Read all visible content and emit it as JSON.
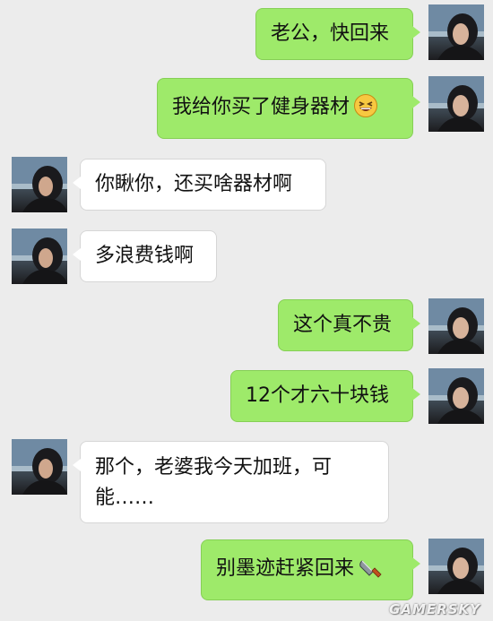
{
  "app": {
    "type": "chat-conversation",
    "colors": {
      "background": "#ececec",
      "sent_bubble": "#9eea6a",
      "received_bubble": "#ffffff"
    }
  },
  "messages": [
    {
      "side": "sent",
      "text": "老公，快回来"
    },
    {
      "side": "sent",
      "text": "我给你买了健身器材",
      "emoji": "grinning-squint-face-icon"
    },
    {
      "side": "received",
      "text": "你瞅你，还买啥器材啊"
    },
    {
      "side": "received",
      "text": "多浪费钱啊"
    },
    {
      "side": "sent",
      "text": "这个真不贵"
    },
    {
      "side": "sent",
      "text": "12个才六十块钱"
    },
    {
      "side": "received",
      "text": "那个，老婆我今天加班，可能……"
    },
    {
      "side": "sent",
      "text": "别墨迹赶紧回来",
      "emoji": "kitchen-knife-icon"
    }
  ],
  "watermark": "GAMERSKY"
}
